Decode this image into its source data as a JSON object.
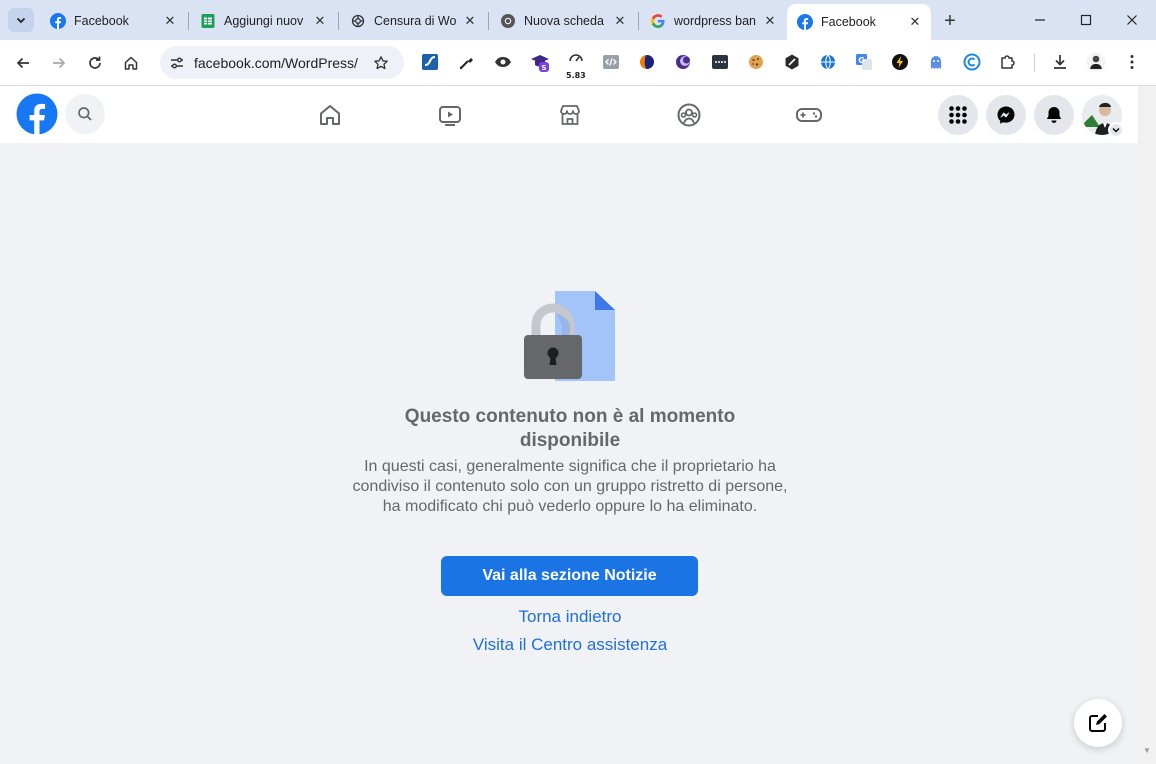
{
  "browser": {
    "tabs": [
      {
        "title": "Facebook",
        "favicon": "facebook-icon",
        "active": false
      },
      {
        "title": "Aggiungi nuov",
        "favicon": "google-sheets-icon",
        "active": false
      },
      {
        "title": "Censura di Wo",
        "favicon": "openai-icon",
        "active": false
      },
      {
        "title": "Nuova scheda",
        "favicon": "chrome-icon",
        "active": false
      },
      {
        "title": "wordpress ban",
        "favicon": "google-icon",
        "active": false
      },
      {
        "title": "Facebook",
        "favicon": "facebook-icon",
        "active": true
      }
    ],
    "close_glyph": "✕",
    "new_tab_glyph": "+",
    "address_bar": {
      "url": "facebook.com/WordPress/"
    },
    "extension_badge": "5.83"
  },
  "colors": {
    "facebook_blue": "#1877f2",
    "button_blue": "#1b74e4",
    "link_blue": "#216fdb",
    "text_gray": "#65676b",
    "page_bg": "#f0f2f5",
    "chrome_frame": "#dae3f4"
  },
  "content": {
    "title": "Questo contenuto non è al momento disponibile",
    "description": "In questi casi, generalmente significa che il proprietario ha condiviso il contenuto solo con un gruppo ristretto di persone, ha modificato chi può vederlo oppure lo ha eliminato.",
    "primary_button": "Vai alla sezione Notizie",
    "back_link": "Torna indietro",
    "help_link": "Visita il Centro assistenza"
  }
}
